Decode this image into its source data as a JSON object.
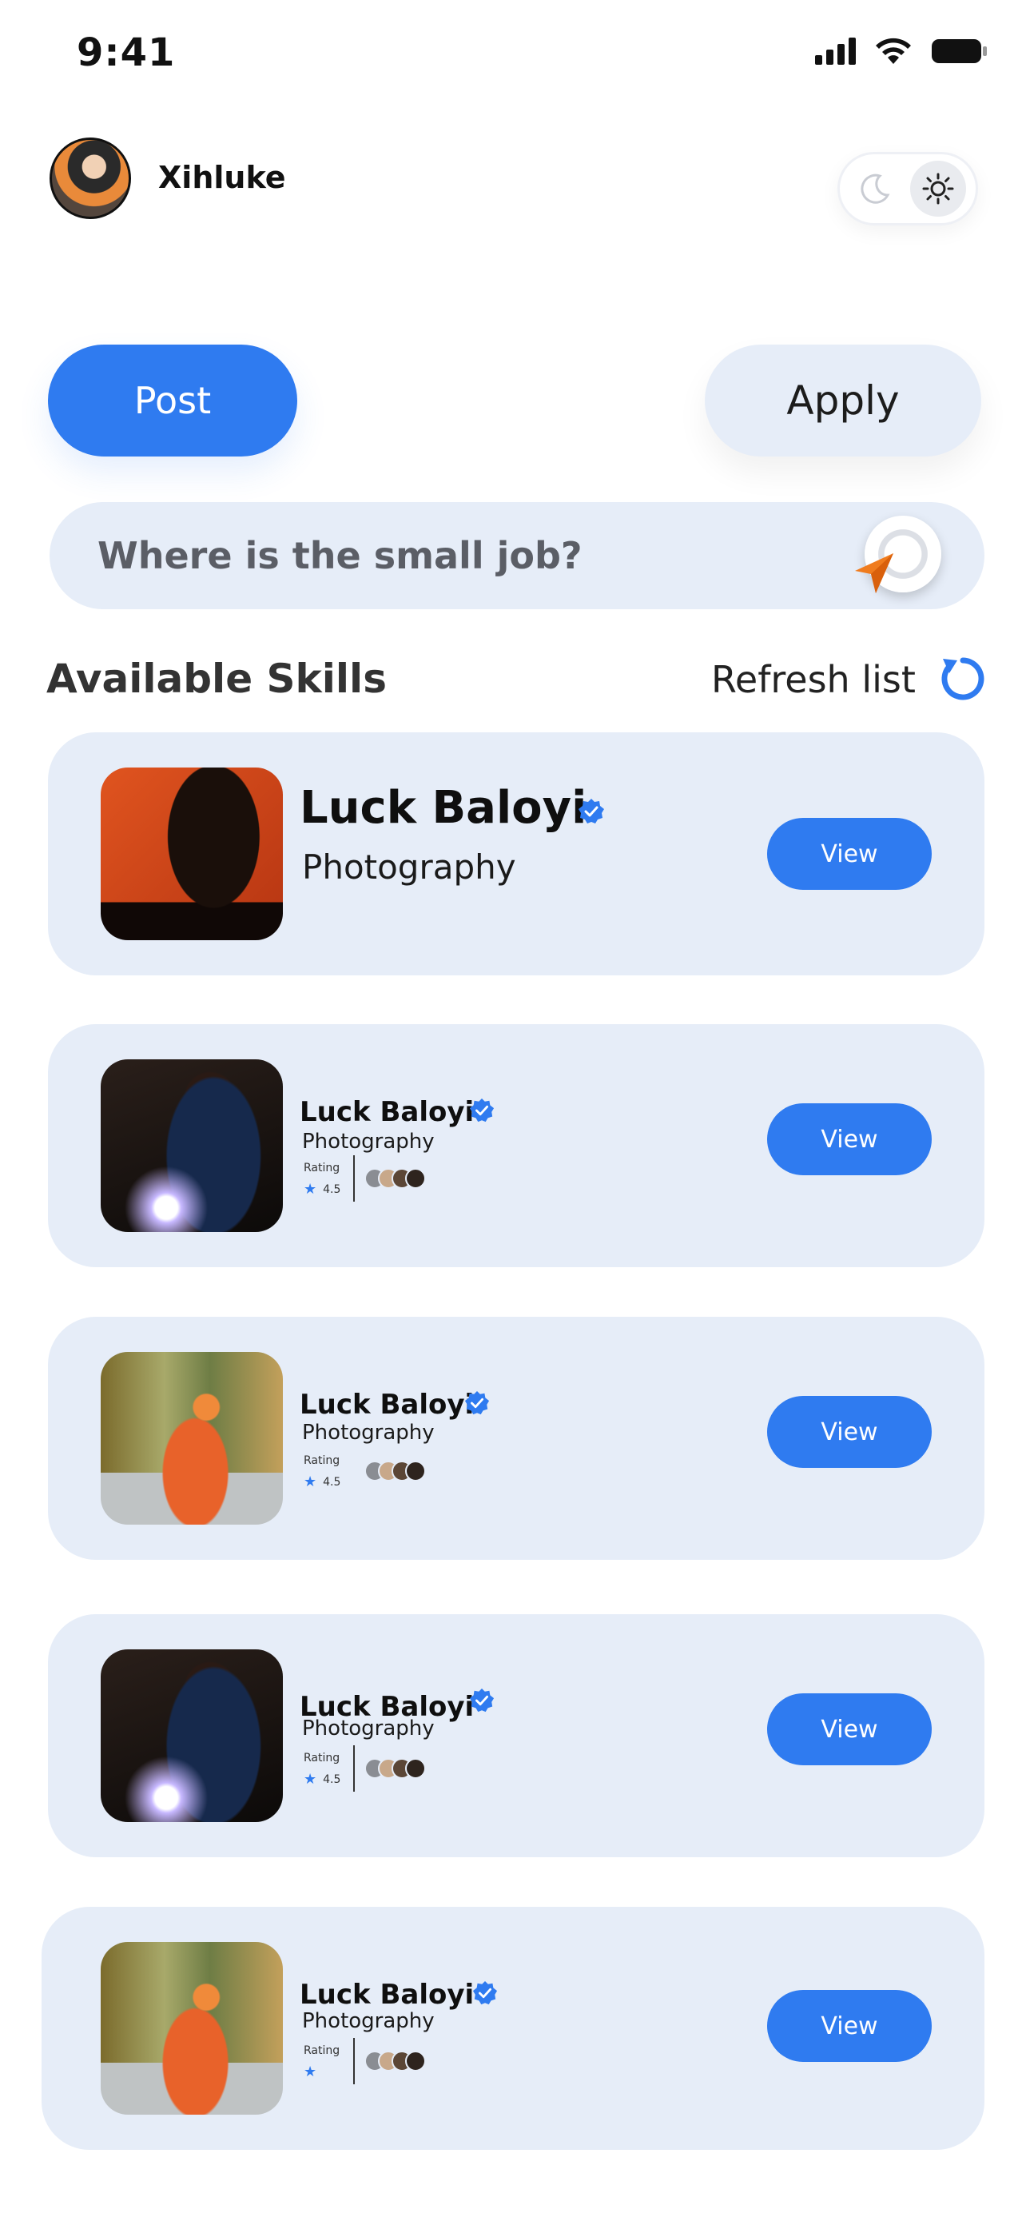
{
  "status_bar": {
    "time": "9:41"
  },
  "profile": {
    "username": "Xihluke"
  },
  "actions": {
    "post_label": "Post",
    "apply_label": "Apply"
  },
  "search": {
    "placeholder": "Where is the small job?"
  },
  "section": {
    "title": "Available Skills",
    "refresh_label": "Refresh list"
  },
  "colors": {
    "accent": "#2f7bf0",
    "card_bg": "#e6edf8",
    "pin": "#f07c1e"
  },
  "cards": [
    {
      "name": "Luck Baloyi",
      "skill": "Photography",
      "view_label": "View",
      "photo": "portrait"
    },
    {
      "name": "Luck Baloyi",
      "skill": "Photography",
      "rating_label": "Rating",
      "rating": "4.5",
      "view_label": "View",
      "photo": "welder"
    },
    {
      "name": "Luck Baloyi",
      "skill": "Photography",
      "rating_label": "Rating",
      "rating": "4.5",
      "view_label": "View",
      "photo": "worker"
    },
    {
      "name": "Luck Baloyi",
      "skill": "Photography",
      "rating_label": "Rating",
      "rating": "4.5",
      "view_label": "View",
      "photo": "welder"
    },
    {
      "name": "Luck Baloyi",
      "skill": "Photography",
      "rating_label": "Rating",
      "view_label": "View",
      "photo": "worker"
    }
  ],
  "icons": {
    "signal": "signal-icon",
    "wifi": "wifi-icon",
    "battery": "battery-icon",
    "moon": "moon-icon",
    "sun": "sun-icon",
    "search": "search-icon",
    "location": "location-pin-icon",
    "refresh": "refresh-icon",
    "verified": "verified-badge-icon",
    "star": "star-icon"
  }
}
